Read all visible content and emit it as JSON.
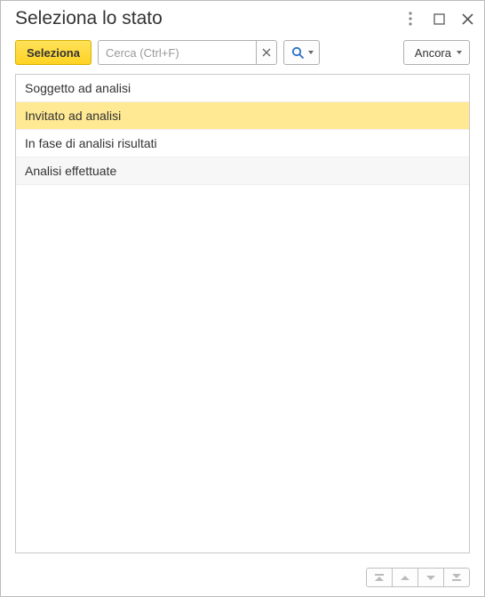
{
  "window": {
    "title": "Seleziona lo stato"
  },
  "toolbar": {
    "select_label": "Seleziona",
    "search_placeholder": "Cerca (Ctrl+F)",
    "search_value": "",
    "more_label": "Ancora"
  },
  "list": {
    "items": [
      {
        "label": "Soggetto ad analisi",
        "selected": false,
        "alt": false
      },
      {
        "label": "Invitato ad analisi",
        "selected": true,
        "alt": false
      },
      {
        "label": "In fase di analisi risultati",
        "selected": false,
        "alt": false
      },
      {
        "label": "Analisi effettuate",
        "selected": false,
        "alt": true
      }
    ]
  }
}
